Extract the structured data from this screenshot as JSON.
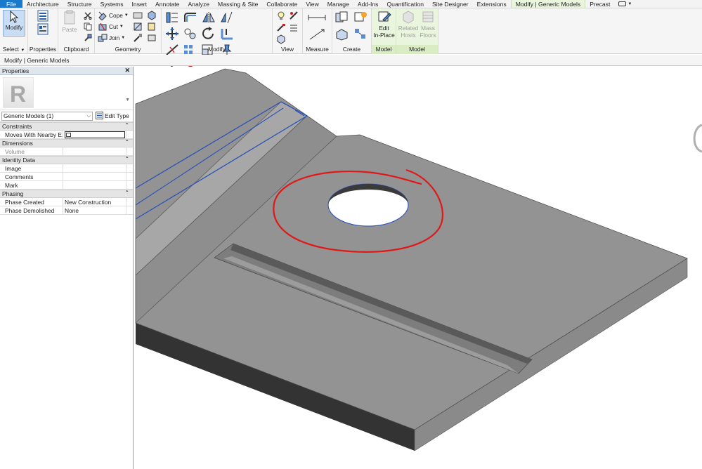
{
  "menu_tabs": [
    "File",
    "Architecture",
    "Structure",
    "Systems",
    "Insert",
    "Annotate",
    "Analyze",
    "Massing & Site",
    "Collaborate",
    "View",
    "Manage",
    "Add-Ins",
    "Quantification",
    "Site Designer",
    "Extensions",
    "Modify | Generic Models",
    "Precast"
  ],
  "ribbon": {
    "select": {
      "big_label": "Modify",
      "panel_label": "Select"
    },
    "properties": {
      "panel_label": "Properties"
    },
    "clipboard": {
      "paste_label": "Paste",
      "panel_label": "Clipboard"
    },
    "geometry": {
      "cope_label": "Cope",
      "cut_label": "Cut",
      "join_label": "Join",
      "panel_label": "Geometry"
    },
    "modify": {
      "panel_label": "Modify"
    },
    "view": {
      "panel_label": "View"
    },
    "measure": {
      "panel_label": "Measure"
    },
    "create": {
      "panel_label": "Create"
    },
    "model1": {
      "btn_line1": "Edit",
      "btn_line2": "In-Place",
      "panel_label": "Model"
    },
    "model2": {
      "related_line1": "Related",
      "related_line2": "Hosts",
      "mass_line1": "Mass",
      "mass_line2": "Floors",
      "panel_label": "Model"
    }
  },
  "context_bar": "Modify | Generic Models",
  "properties_palette": {
    "title": "Properties",
    "type_selector": "Generic Models (1)",
    "edit_type": "Edit Type",
    "groups": [
      {
        "name": "Constraints",
        "rows": [
          {
            "key": "Moves With Nearby E...",
            "value": "",
            "checkbox": true
          }
        ]
      },
      {
        "name": "Dimensions",
        "rows": [
          {
            "key": "Volume",
            "value": "",
            "dim": true
          }
        ]
      },
      {
        "name": "Identity Data",
        "rows": [
          {
            "key": "Image",
            "value": ""
          },
          {
            "key": "Comments",
            "value": ""
          },
          {
            "key": "Mark",
            "value": ""
          }
        ]
      },
      {
        "name": "Phasing",
        "rows": [
          {
            "key": "Phase Created",
            "value": "New Construction"
          },
          {
            "key": "Phase Demolished",
            "value": "None"
          }
        ]
      }
    ]
  },
  "colors": {
    "file_tab": "#1979ca",
    "context_tab": "#e9f5dc",
    "markup": "#e01818",
    "selection": "#2b52b8",
    "slab_top": "#939393",
    "slab_front": "#333333"
  }
}
